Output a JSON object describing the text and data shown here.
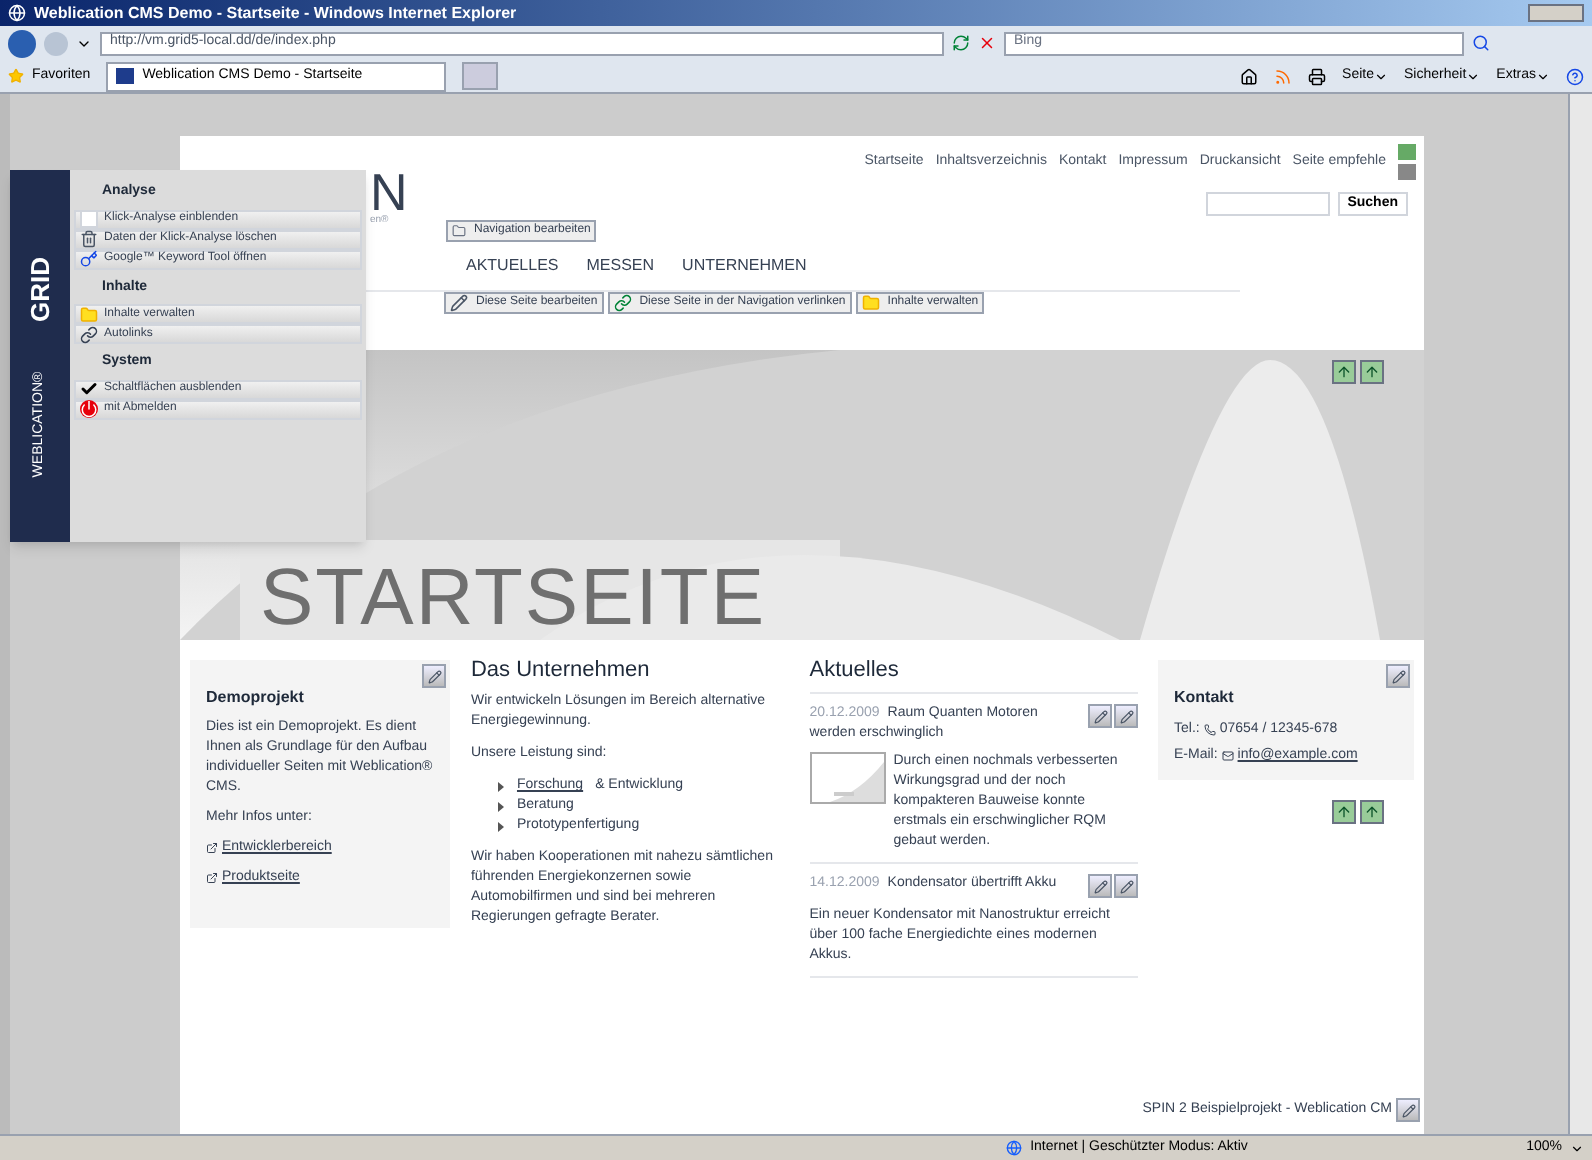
{
  "browser": {
    "title": "Weblication CMS Demo - Startseite - Windows Internet Explorer",
    "address": "http://vm.grid5-local.dd/de/index.php",
    "search_placeholder": "Bing",
    "favorites": "Favoriten",
    "tabs": [
      {
        "label": "Weblication CMS Demo - Startseite",
        "selected": true
      }
    ],
    "commands": [
      "Seite",
      "Sicherheit",
      "Extras"
    ]
  },
  "grid_panel": {
    "brand": "GRID",
    "product": "WEBLICATION®",
    "sections": [
      {
        "title": "Analyse",
        "items": [
          {
            "label": "Klick-Analyse einblenden",
            "kind": "check",
            "checked": false
          },
          {
            "label": "Daten der Klick-Analyse löschen",
            "kind": "trash"
          },
          {
            "label": "Google™ Keyword Tool öffnen",
            "kind": "key"
          }
        ]
      },
      {
        "title": "Inhalte",
        "items": [
          {
            "label": "Inhalte verwalten",
            "kind": "folder"
          },
          {
            "label": "Autolinks",
            "kind": "link"
          }
        ]
      },
      {
        "title": "System",
        "items": [
          {
            "label": "Schaltflächen ausblenden",
            "kind": "check",
            "checked": true
          },
          {
            "label": "mit Abmelden",
            "kind": "logout"
          }
        ]
      }
    ]
  },
  "header": {
    "logo": "N",
    "tagline": "en®",
    "top_links": [
      "Startseite",
      "Inhaltsverzeichnis",
      "Kontakt",
      "Impressum",
      "Druckansicht",
      "Seite empfehle"
    ],
    "search_button": "Suchen",
    "nav_edit_button": "Navigation bearbeiten",
    "nav": [
      "AKTUELLES",
      "MESSEN",
      "UNTERNEHMEN"
    ],
    "edit_buttons": [
      {
        "label": "Diese Seite bearbeiten",
        "kind": "edit"
      },
      {
        "label": "Diese Seite in der Navigation verlinken",
        "kind": "link"
      },
      {
        "label": "Inhalte verwalten",
        "kind": "folder"
      }
    ]
  },
  "hero": {
    "title": "STARTSEITE"
  },
  "demoprojekt": {
    "title": "Demoprojekt",
    "text": "Dies ist ein Demoprojekt. Es dient Ihnen als Grundlage für den Aufbau individueller Seiten mit Weblication® CMS.",
    "more": "Mehr Infos unter:",
    "links": [
      "Entwicklerbereich",
      "Produktseite"
    ]
  },
  "unternehmen": {
    "title": "Das Unternehmen",
    "intro": "Wir entwickeln Lösungen im Bereich alternative Energiegewinnung.",
    "list_title": "Unsere Leistung sind:",
    "list": [
      {
        "link": "Forschung",
        "text": "& Entwicklung"
      },
      {
        "text": "Beratung"
      },
      {
        "text": "Prototypenfertigung"
      }
    ],
    "outro": "Wir haben Kooperationen mit nahezu sämtlichen führenden Energiekonzernen sowie Automobilfirmen und sind bei mehreren Regierungen gefragte Berater."
  },
  "aktuelles": {
    "title": "Aktuelles",
    "news": [
      {
        "date": "20.12.2009",
        "title": "Raum Quanten Motoren werden erschwinglich",
        "text": "Durch einen nochmals verbesserten Wirkungsgrad und der noch kompakteren Bauweise konnte erstmals ein erschwinglicher RQM gebaut werden."
      },
      {
        "date": "14.12.2009",
        "title": "Kondensator übertrifft Akku",
        "text": "Ein neuer Kondensator mit Nanostruktur erreicht über 100 fache Energiedichte eines modernen Akkus.",
        "kind": "text"
      }
    ]
  },
  "kontakt": {
    "title": "Kontakt",
    "tel_label": "Tel.:",
    "tel": "07654 / 12345-678",
    "mail_label": "E-Mail:",
    "mail": "info@example.com"
  },
  "footer": "SPIN 2 Beispielprojekt - Weblication CM",
  "status_bar": {
    "zone": "Internet | Geschützter Modus: Aktiv",
    "zoom": "100%"
  }
}
